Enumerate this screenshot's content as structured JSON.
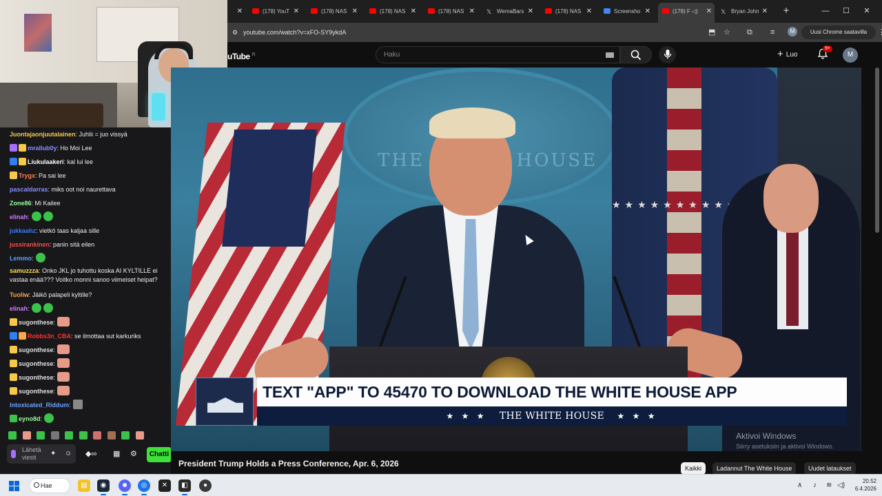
{
  "browser": {
    "tabs": [
      {
        "label": "",
        "icon": "close-icon"
      },
      {
        "label": "(178) YouT",
        "icon": "youtube-icon"
      },
      {
        "label": "(178) NAS",
        "icon": "youtube-icon"
      },
      {
        "label": "(178) NAS",
        "icon": "youtube-icon"
      },
      {
        "label": "(178) NAS",
        "icon": "youtube-icon"
      },
      {
        "label": "WemaBars",
        "icon": "x-icon"
      },
      {
        "label": "(178) NAS",
        "icon": "youtube-icon"
      },
      {
        "label": "Screensho",
        "icon": "google-icon"
      },
      {
        "label": "(178) F",
        "icon": "youtube-icon",
        "active": true
      },
      {
        "label": "Bryan John",
        "icon": "x-icon"
      }
    ],
    "url": "youtube.com/watch?v=xFO-SY9ykdA",
    "chrome_prompt": "Uusi Chrome saatavilla",
    "profile_initial": "M"
  },
  "youtube": {
    "logo": "uTube",
    "logo_region": "FI",
    "search_placeholder": "Haku",
    "create_label": "Luo",
    "notification_count": "9+",
    "avatar_initial": "M",
    "video_title": "President Trump Holds a Press Conference, Apr. 6, 2026",
    "chips": [
      "Kaikki",
      "Ladannut The White House",
      "Uudet lataukset"
    ]
  },
  "video": {
    "headline": "TEXT \"APP\" TO 45470 TO DOWNLOAD THE WHITE HOUSE APP",
    "org": "THE WHITE HOUSE",
    "stars": "★ ★ ★",
    "seal_text": "THE WHITE HOUSE",
    "watermark_title": "Aktivoi Windows",
    "watermark_sub": "Siirry asetuksiin ja aktivoi Windows."
  },
  "chat": {
    "messages": [
      {
        "user": "Juontajaonjuutalainen",
        "color": "#f7c84a",
        "text": ": Juhlii = juo vissyä",
        "badges": []
      },
      {
        "user": "mrallub0y",
        "color": "#8a8aff",
        "text": ": Ho Moi Lee",
        "badges": [
          "#a970ff",
          "#f7c84a"
        ]
      },
      {
        "user": "Liukulaakeri",
        "color": "#ffffff",
        "text": ": kal lui lee",
        "badges": [
          "#2f7ff0",
          "#f7c84a"
        ]
      },
      {
        "user": "Trygx",
        "color": "#ff7f50",
        "text": ": Pa sai lee",
        "badges": [
          "#f7c84a"
        ]
      },
      {
        "user": "pascaldarras",
        "color": "#8a8aff",
        "text": ": miks oot noi naurettava",
        "badges": []
      },
      {
        "user": "Zone86",
        "color": "#9aff9a",
        "text": ": Mi Kailee",
        "badges": []
      },
      {
        "user": "elinah",
        "color": "#d27bff",
        "text": ":",
        "badges": [],
        "emotes": [
          "frog",
          "frog"
        ]
      },
      {
        "user": "jukkaahz",
        "color": "#3a7bff",
        "text": ": vietkö taas kaljaa sille",
        "badges": []
      },
      {
        "user": "jussirankinen",
        "color": "#ff4a4a",
        "text": ": panin sitä eilen",
        "badges": []
      },
      {
        "user": "Lemmo",
        "color": "#5aa0ff",
        "text": ":",
        "badges": [],
        "emotes": [
          "frog"
        ]
      },
      {
        "user": "samuzzza",
        "color": "#f7e04a",
        "text": ": Onko JKL jo tuhottu koska AI KYLTILLE ei vastaa enää??? Voitko monni sanoo viimeiset heipat?",
        "badges": [],
        "two": true
      },
      {
        "user": "Tuoliw",
        "color": "#f7a84a",
        "text": ": Jäikö palapeli kyltille?",
        "badges": []
      },
      {
        "user": "elinah",
        "color": "#d27bff",
        "text": ":",
        "badges": [],
        "emotes": [
          "frog",
          "frog"
        ]
      },
      {
        "user": "sugonthese",
        "color": "#e0e0e0",
        "text": ":",
        "badges": [
          "#f7c84a"
        ],
        "emotes": [
          "hand"
        ]
      },
      {
        "user": "Robbs3n_CBA",
        "color": "#ff3030",
        "text": ": se ilmottaa sut karkuriks",
        "badges": [
          "#2f7ff0",
          "#f7a84a"
        ]
      },
      {
        "user": "sugonthese",
        "color": "#e0e0e0",
        "text": ":",
        "badges": [
          "#f7c84a"
        ],
        "emotes": [
          "hand"
        ]
      },
      {
        "user": "sugonthese",
        "color": "#e0e0e0",
        "text": ":",
        "badges": [
          "#f7c84a"
        ],
        "emotes": [
          "hand"
        ]
      },
      {
        "user": "sugonthese",
        "color": "#e0e0e0",
        "text": ":",
        "badges": [
          "#f7c84a"
        ],
        "emotes": [
          "hand"
        ]
      },
      {
        "user": "sugonthese",
        "color": "#e0e0e0",
        "text": ":",
        "badges": [
          "#f7c84a"
        ],
        "emotes": [
          "hand"
        ]
      },
      {
        "user": "Intoxicated_Riddum",
        "color": "#6aa0ff",
        "text": ":",
        "badges": [],
        "emotes": [
          "gray"
        ]
      },
      {
        "user": "eyno8d",
        "color": "#9aff9a",
        "text": ":",
        "badges": [
          "#3cc24a"
        ],
        "emotes": [
          "frog"
        ]
      }
    ],
    "input_placeholder": "Lähetä viesti",
    "chat_button": "Chatti"
  },
  "taskbar": {
    "search_label": "Hae",
    "time": "20.52",
    "date": "6.4.2026"
  }
}
